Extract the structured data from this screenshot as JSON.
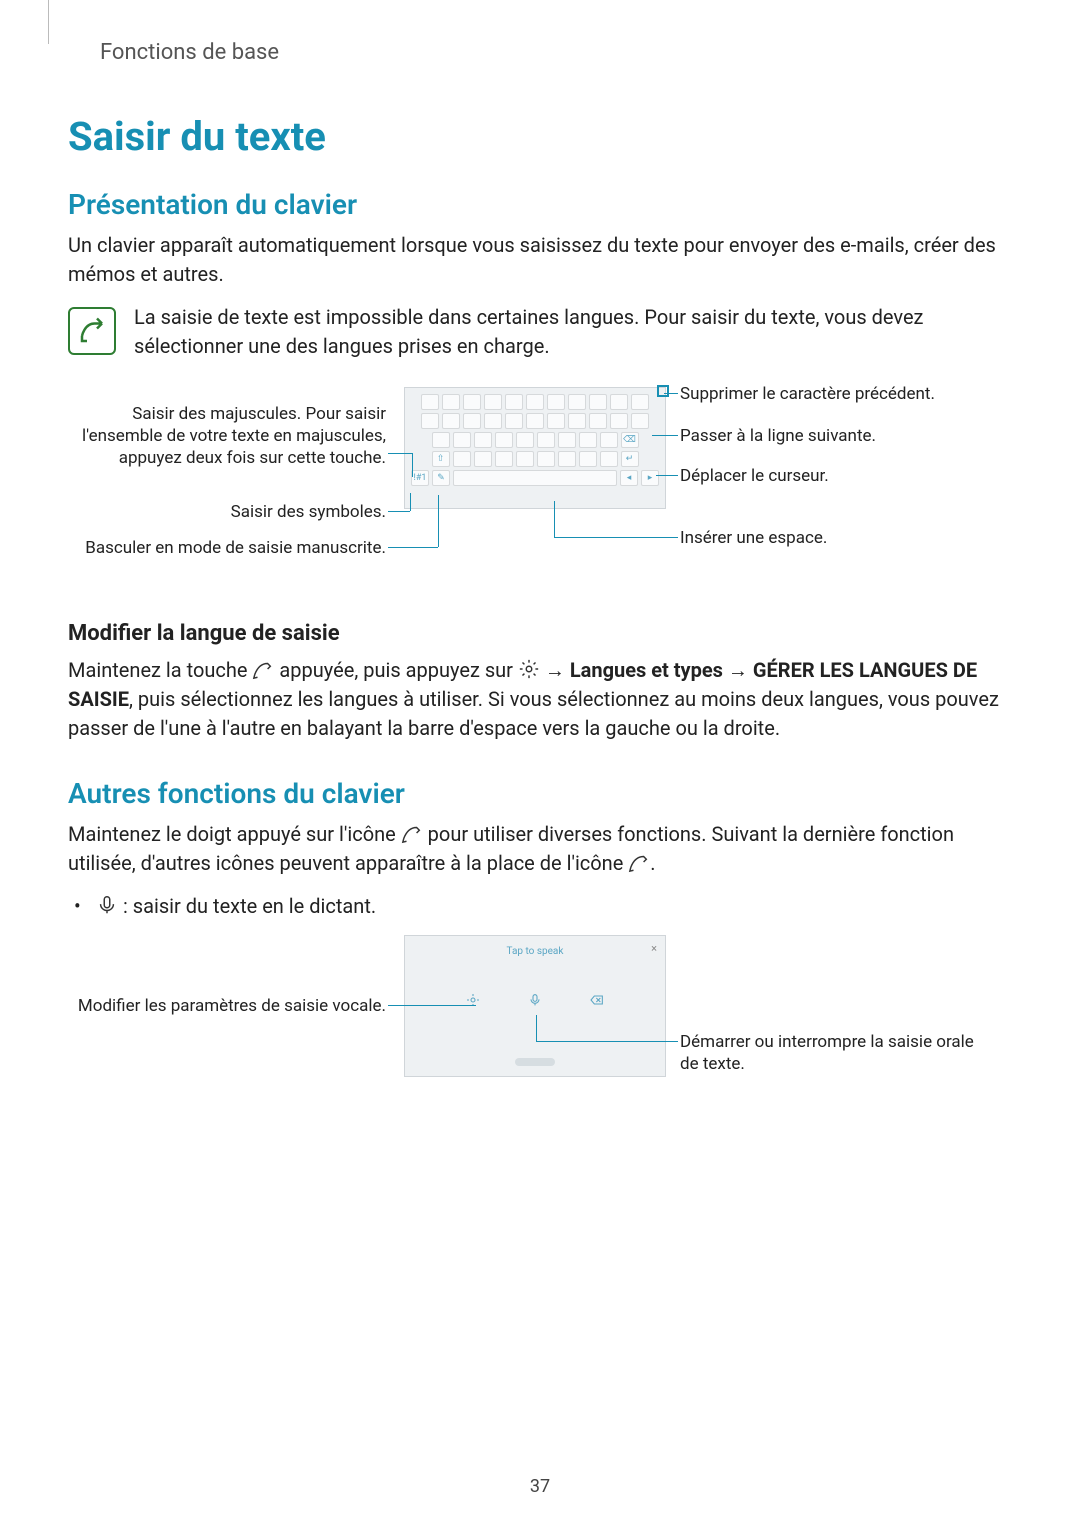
{
  "header": {
    "breadcrumb": "Fonctions de base"
  },
  "title": "Saisir du texte",
  "s1": {
    "heading": "Présentation du clavier",
    "intro": "Un clavier apparaît automatiquement lorsque vous saisissez du texte pour envoyer des e-mails, créer des mémos et autres.",
    "note": "La saisie de texte est impossible dans certaines langues. Pour saisir du texte, vous devez sélectionner une des langues prises en charge.",
    "callouts": {
      "left1": "Saisir des majuscules. Pour saisir l'ensemble de votre texte en majuscules, appuyez deux fois sur cette touche.",
      "left2": "Saisir des symboles.",
      "left3": "Basculer en mode de saisie manuscrite.",
      "right1": "Supprimer le caractère précédent.",
      "right2": "Passer à la ligne suivante.",
      "right3": "Déplacer le curseur.",
      "right4": "Insérer une espace."
    }
  },
  "s2": {
    "heading": "Modifier la langue de saisie",
    "p_a": "Maintenez la touche ",
    "p_b": " appuyée, puis appuyez sur ",
    "p_c": " → ",
    "bold1": "Langues et types",
    "p_d": " → ",
    "bold2": "GÉRER LES LANGUES DE SAISIE",
    "p_e": ", puis sélectionnez les langues à utiliser. Si vous sélectionnez au moins deux langues, vous pouvez passer de l'une à l'autre en balayant la barre d'espace vers la gauche ou la droite."
  },
  "s3": {
    "heading": "Autres fonctions du clavier",
    "p_a": "Maintenez le doigt appuyé sur l'icône ",
    "p_b": " pour utiliser diverses fonctions. Suivant la dernière fonction utilisée, d'autres icônes peuvent apparaître à la place de l'icône ",
    "p_c": ".",
    "bullet1": " : saisir du texte en le dictant.",
    "voice_hint": "Tap to speak",
    "callouts": {
      "left1": "Modifier les paramètres de saisie vocale.",
      "right1": "Démarrer ou interrompre la saisie orale de texte."
    }
  },
  "page_no": "37"
}
